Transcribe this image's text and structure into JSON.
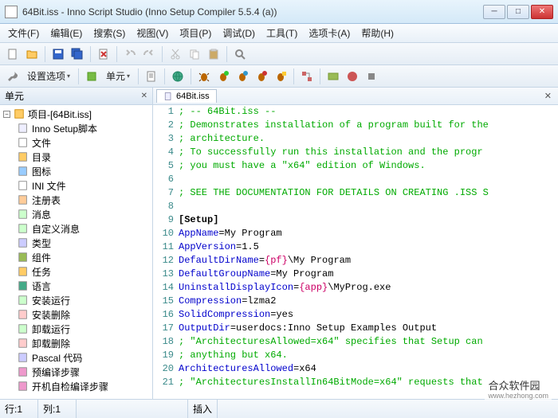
{
  "window": {
    "title": "64Bit.iss - Inno Script Studio (Inno Setup Compiler 5.5.4 (a))"
  },
  "menu": {
    "file": "文件(F)",
    "edit": "编辑(E)",
    "search": "搜索(S)",
    "view": "视图(V)",
    "project": "项目(P)",
    "debug": "调试(D)",
    "tools": "工具(T)",
    "tabs": "选项卡(A)",
    "help": "帮助(H)"
  },
  "toolbar": {
    "settings": "设置选项",
    "unit": "单元"
  },
  "sidebar": {
    "title": "单元",
    "root": "项目-[64Bit.iss]",
    "items": [
      "Inno Setup脚本",
      "文件",
      "目录",
      "图标",
      "INI 文件",
      "注册表",
      "消息",
      "自定义消息",
      "类型",
      "组件",
      "任务",
      "语言",
      "安装运行",
      "安装删除",
      "卸载运行",
      "卸载删除",
      "Pascal 代码",
      "预编译步骤",
      "开机自检编译步骤"
    ]
  },
  "tab": {
    "name": "64Bit.iss"
  },
  "code": [
    {
      "n": 1,
      "seg": [
        {
          "c": "comment",
          "t": "; -- 64Bit.iss --"
        }
      ]
    },
    {
      "n": 2,
      "seg": [
        {
          "c": "comment",
          "t": "; Demonstrates installation of a program built for the"
        }
      ]
    },
    {
      "n": 3,
      "seg": [
        {
          "c": "comment",
          "t": "; architecture."
        }
      ]
    },
    {
      "n": 4,
      "seg": [
        {
          "c": "comment",
          "t": "; To successfully run this installation and the progr"
        }
      ]
    },
    {
      "n": 5,
      "seg": [
        {
          "c": "comment",
          "t": "; you must have a \"x64\" edition of Windows."
        }
      ]
    },
    {
      "n": 6,
      "seg": []
    },
    {
      "n": 7,
      "seg": [
        {
          "c": "comment",
          "t": "; SEE THE DOCUMENTATION FOR DETAILS ON CREATING .ISS S"
        }
      ]
    },
    {
      "n": 8,
      "seg": []
    },
    {
      "n": 9,
      "seg": [
        {
          "c": "section",
          "t": "[Setup]"
        }
      ]
    },
    {
      "n": 10,
      "seg": [
        {
          "c": "key",
          "t": "AppName"
        },
        {
          "c": "",
          "t": "=My Program"
        }
      ]
    },
    {
      "n": 11,
      "seg": [
        {
          "c": "key",
          "t": "AppVersion"
        },
        {
          "c": "",
          "t": "=1.5"
        }
      ]
    },
    {
      "n": 12,
      "seg": [
        {
          "c": "key",
          "t": "DefaultDirName"
        },
        {
          "c": "",
          "t": "="
        },
        {
          "c": "const",
          "t": "{pf}"
        },
        {
          "c": "",
          "t": "\\My Program"
        }
      ]
    },
    {
      "n": 13,
      "seg": [
        {
          "c": "key",
          "t": "DefaultGroupName"
        },
        {
          "c": "",
          "t": "=My Program"
        }
      ]
    },
    {
      "n": 14,
      "seg": [
        {
          "c": "key",
          "t": "UninstallDisplayIcon"
        },
        {
          "c": "",
          "t": "="
        },
        {
          "c": "const",
          "t": "{app}"
        },
        {
          "c": "",
          "t": "\\MyProg.exe"
        }
      ]
    },
    {
      "n": 15,
      "seg": [
        {
          "c": "key",
          "t": "Compression"
        },
        {
          "c": "",
          "t": "=lzma2"
        }
      ]
    },
    {
      "n": 16,
      "seg": [
        {
          "c": "key",
          "t": "SolidCompression"
        },
        {
          "c": "",
          "t": "=yes"
        }
      ]
    },
    {
      "n": 17,
      "seg": [
        {
          "c": "key",
          "t": "OutputDir"
        },
        {
          "c": "",
          "t": "=userdocs:Inno Setup Examples Output"
        }
      ]
    },
    {
      "n": 18,
      "seg": [
        {
          "c": "comment",
          "t": "; \"ArchitecturesAllowed=x64\" specifies that Setup can"
        }
      ]
    },
    {
      "n": 19,
      "seg": [
        {
          "c": "comment",
          "t": "; anything but x64."
        }
      ]
    },
    {
      "n": 20,
      "seg": [
        {
          "c": "key",
          "t": "ArchitecturesAllowed"
        },
        {
          "c": "",
          "t": "=x64"
        }
      ]
    },
    {
      "n": 21,
      "seg": [
        {
          "c": "comment",
          "t": "; \"ArchitecturesInstallIn64BitMode=x64\" requests that "
        }
      ]
    }
  ],
  "status": {
    "line_lbl": "行:",
    "line": "1",
    "col_lbl": "列:",
    "col": "1",
    "insert": "插入"
  },
  "watermark": {
    "main": "合众软件园",
    "sub": "www.hezhong.com"
  }
}
